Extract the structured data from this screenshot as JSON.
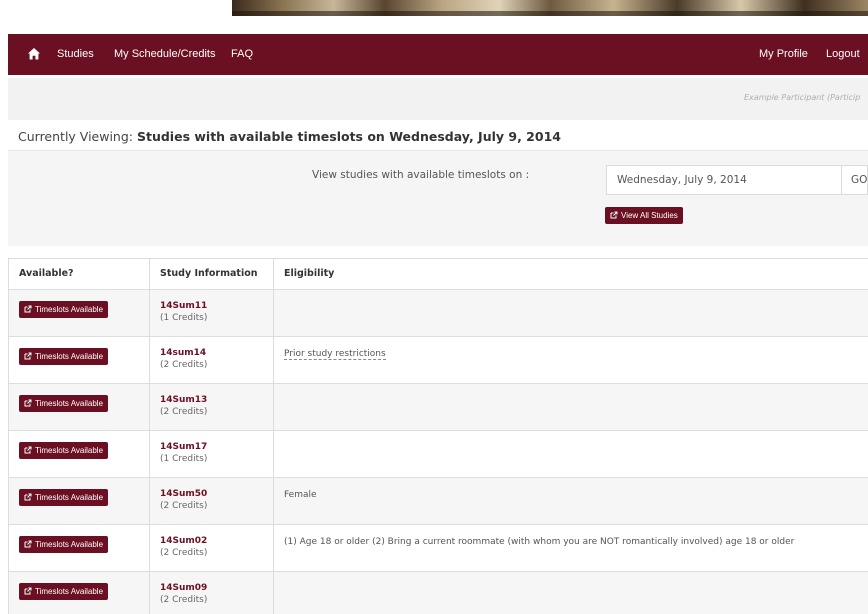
{
  "nav": {
    "home_icon": "home-icon",
    "studies": "Studies",
    "schedule": "My Schedule/Credits",
    "faq": "FAQ",
    "profile": "My Profile",
    "logout": "Logout"
  },
  "participant": "Example Participant (Particip",
  "current": {
    "label": "Currently Viewing:",
    "value": "Studies with available timeslots on Wednesday, July 9, 2014"
  },
  "filter": {
    "label": "View studies with available timeslots on :",
    "date_value": "Wednesday, July 9, 2014",
    "go_label": "GO",
    "view_all_label": "View All Studies",
    "view_all_icon": "external-link-icon"
  },
  "table": {
    "headers": [
      "Available?",
      "Study Information",
      "Eligibility"
    ],
    "rows": [
      {
        "button": "Timeslots Available",
        "study": "14Sum11",
        "credits": "(1 Credits)",
        "eligibility": ""
      },
      {
        "button": "Timeslots Available",
        "study": "14sum14",
        "credits": "(2 Credits)",
        "eligibility": "Prior study restrictions"
      },
      {
        "button": "Timeslots Available",
        "study": "14Sum13",
        "credits": "(2 Credits)",
        "eligibility": ""
      },
      {
        "button": "Timeslots Available",
        "study": "14Sum17",
        "credits": "(1 Credits)",
        "eligibility": ""
      },
      {
        "button": "Timeslots Available",
        "study": "14Sum50",
        "credits": "(2 Credits)",
        "eligibility": "Female"
      },
      {
        "button": "Timeslots Available",
        "study": "14Sum02",
        "credits": "(2 Credits)",
        "eligibility": "(1) Age 18 or older (2) Bring a current roommate (with whom you are NOT romantically involved) age 18 or older"
      },
      {
        "button": "Timeslots Available",
        "study": "14Sum09",
        "credits": "(2 Credits)",
        "eligibility": ""
      }
    ]
  },
  "colors": {
    "brand": "#6b0f22",
    "subbar": "#f2f2f2",
    "panel": "#f5f5f5"
  }
}
